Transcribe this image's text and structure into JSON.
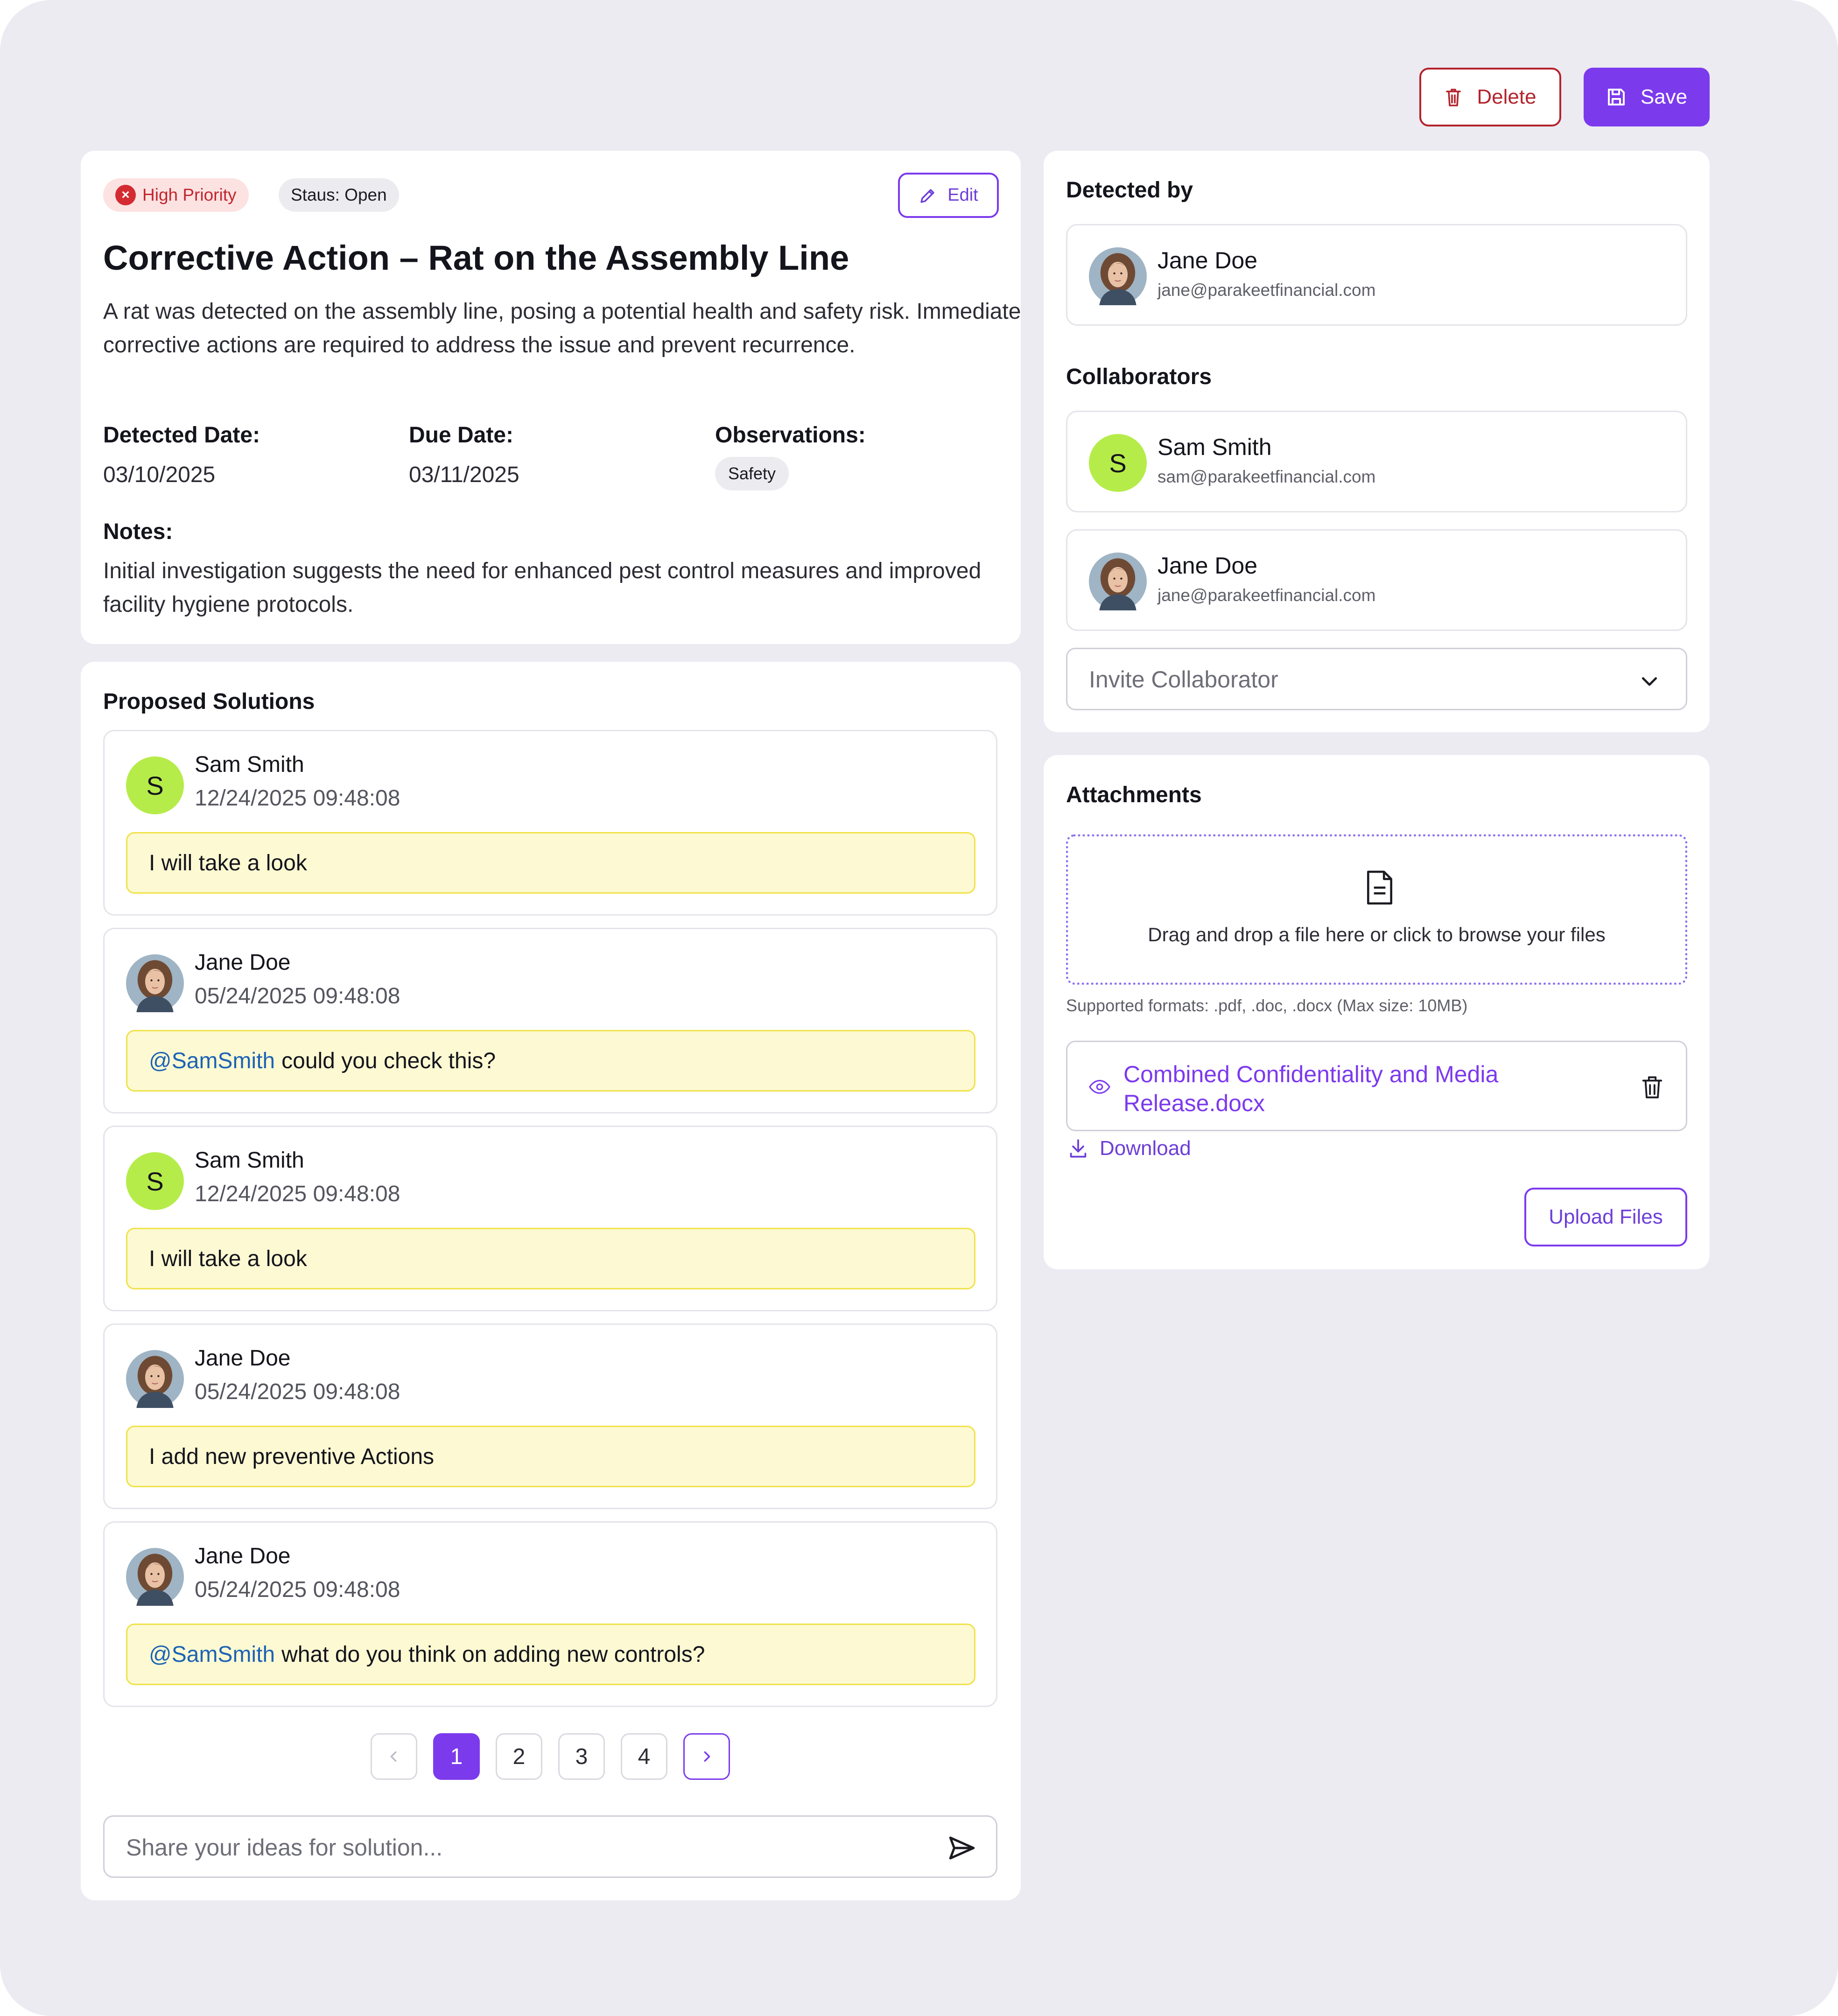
{
  "toolbar": {
    "delete_label": "Delete",
    "save_label": "Save"
  },
  "action": {
    "priority_label": "High Priority",
    "status_label": "Staus: Open",
    "edit_label": "Edit",
    "title": "Corrective Action – Rat on the Assembly Line",
    "description": "A rat was detected on the assembly line, posing a potential health and safety risk. Immediate corrective actions are required to address the issue and prevent recurrence.",
    "detected_date_label": "Detected Date:",
    "detected_date": "03/10/2025",
    "due_date_label": "Due Date:",
    "due_date": "03/11/2025",
    "observations_label": "Observations:",
    "observation_tag": "Safety",
    "notes_label": "Notes:",
    "notes": "Initial investigation suggests the need for enhanced pest control measures and improved facility hygiene protocols."
  },
  "solutions": {
    "title": "Proposed Solutions",
    "comments": [
      {
        "avatar": "S",
        "name": "Sam Smith",
        "time": "12/24/2025 09:48:08",
        "mention": "",
        "text": "I will take a look"
      },
      {
        "avatar": "photo",
        "name": "Jane Doe",
        "time": "05/24/2025 09:48:08",
        "mention": "@SamSmith",
        "text": "could you check this?"
      },
      {
        "avatar": "S",
        "name": "Sam Smith",
        "time": "12/24/2025 09:48:08",
        "mention": "",
        "text": "I will take a look"
      },
      {
        "avatar": "photo",
        "name": "Jane Doe",
        "time": "05/24/2025 09:48:08",
        "mention": "",
        "text": "I add new preventive Actions"
      },
      {
        "avatar": "photo",
        "name": "Jane Doe",
        "time": "05/24/2025 09:48:08",
        "mention": "@SamSmith",
        "text": "what do you think on adding new controls?"
      }
    ],
    "pagination": {
      "prev_icon": "chevron-left",
      "pages": [
        "1",
        "2",
        "3",
        "4"
      ],
      "current": "1",
      "next_icon": "chevron-right"
    },
    "composer_placeholder": "Share your ideas for solution...",
    "send_icon": "send-icon"
  },
  "detected_by": {
    "title": "Detected by",
    "person": {
      "name": "Jane Doe",
      "email": "jane@parakeetfinancial.com"
    }
  },
  "collaborators": {
    "title": "Collaborators",
    "people": [
      {
        "avatar": "S",
        "name": "Sam Smith",
        "email": "sam@parakeetfinancial.com"
      },
      {
        "avatar": "photo",
        "name": "Jane Doe",
        "email": "jane@parakeetfinancial.com"
      }
    ],
    "invite_placeholder": "Invite Collaborator"
  },
  "attachments": {
    "title": "Attachments",
    "dropzone_text": "Drag and drop a file here or click to browse your files",
    "formats_note": "Supported formats: .pdf, .doc, .docx (Max size: 10MB)",
    "file_name": "Combined Confidentiality and Media Release.docx",
    "download_label": "Download",
    "upload_label": "Upload Files"
  },
  "colors": {
    "accent": "#7c3aed",
    "danger": "#b4232c",
    "mention": "#1c63b6",
    "bubble_bg": "#fdf9d2",
    "avatar_s": "#b6ec4a",
    "page_bg": "#ecebf2"
  }
}
